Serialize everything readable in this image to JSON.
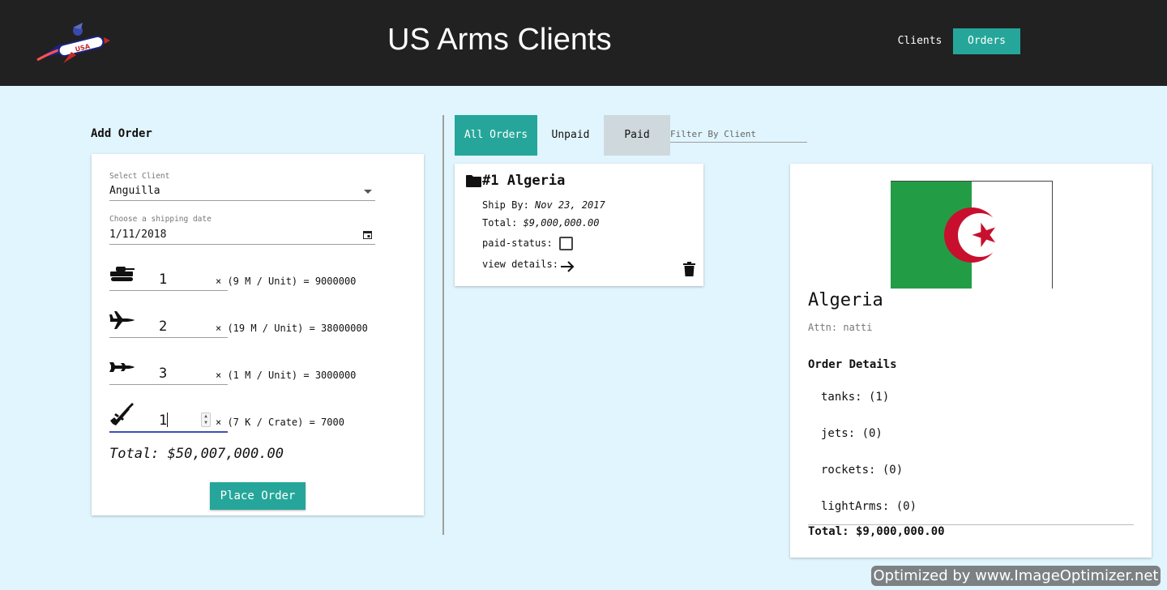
{
  "header": {
    "title": "US Arms Clients",
    "logo_icon": "rocket-logo-icon",
    "logo_text": "USA",
    "nav": {
      "clients": "Clients",
      "orders": "Orders"
    },
    "colors": {
      "bar": "#212121",
      "accent": "#26a69a"
    }
  },
  "add_order": {
    "title": "Add Order",
    "client": {
      "label": "Select Client",
      "value": "Anguilla"
    },
    "date": {
      "label": "Choose a shipping date",
      "value": "1/11/2018"
    },
    "items": [
      {
        "icon": "tank-icon",
        "qty": "1",
        "calc": "× (9 M / Unit) = 9000000"
      },
      {
        "icon": "jet-icon",
        "qty": "2",
        "calc": "× (19 M / Unit) = 38000000"
      },
      {
        "icon": "rocket-icon",
        "qty": "3",
        "calc": "× (1 M / Unit) = 3000000"
      },
      {
        "icon": "rifle-icon",
        "qty": "1",
        "calc": "× (7 K / Crate) = 7000"
      }
    ],
    "total": "Total: $50,007,000.00",
    "place_button": "Place Order"
  },
  "orders": {
    "tabs": {
      "all": "All Orders",
      "unpaid": "Unpaid",
      "paid": "Paid"
    },
    "filter_placeholder": "Filter By Client",
    "card": {
      "title": "#1 Algeria",
      "ship_label": "Ship By: ",
      "ship_value": "Nov 23, 2017",
      "total_label": "Total: ",
      "total_value": "$9,000,000.00",
      "paid_label": "paid-status:",
      "paid": false,
      "details_label": "view details:"
    }
  },
  "details": {
    "name": "Algeria",
    "attn": "Attn: natti",
    "heading": "Order Details",
    "items": [
      "tanks: (1)",
      "jets: (0)",
      "rockets: (0)",
      "lightArms: (0)"
    ],
    "total": "Total: $9,000,000.00",
    "flag_colors": {
      "green": "#239d45",
      "white": "#ffffff",
      "red": "#c8102e"
    }
  },
  "watermark": "Optimized by www.ImageOptimizer.net"
}
